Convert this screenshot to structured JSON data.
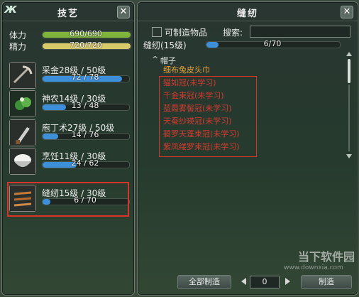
{
  "left_panel": {
    "title": "技艺",
    "close_label": "✕",
    "hp_label": "体力",
    "hp_value": "690/690",
    "hp_fraction": 1.0,
    "mp_label": "精力",
    "mp_value": "720/720",
    "mp_fraction": 1.0,
    "skills": [
      {
        "name": "采金28级 / 50级",
        "progress": "72 / 78",
        "fraction": 0.92,
        "icon": "pickaxe-icon"
      },
      {
        "name": "神农14级 / 30级",
        "progress": "13 / 48",
        "fraction": 0.27,
        "icon": "herb-icon"
      },
      {
        "name": "庖丁术27级 / 50级",
        "progress": "14 / 76",
        "fraction": 0.18,
        "icon": "knife-icon"
      },
      {
        "name": "烹饪11级 / 30级",
        "progress": "24 / 62",
        "fraction": 0.39,
        "icon": "rice-bowl-icon"
      },
      {
        "name": "缝纫15级 / 30级",
        "progress": "6 / 70",
        "fraction": 0.09,
        "icon": "sewing-icon"
      }
    ]
  },
  "right_panel": {
    "title": "缝纫",
    "close_label": "✕",
    "checkbox_label": "可制造物品",
    "search_label": "搜索:",
    "skill_label": "缝纫(15级)",
    "skill_progress": "6/70",
    "skill_fraction": 0.09,
    "category": "帽子",
    "category_marker": "^",
    "items": [
      {
        "name": "细布兔皮头巾",
        "color": "#e8a23a"
      },
      {
        "name": "猫如冠(未学习)",
        "color": "#d33a2e"
      },
      {
        "name": "千金束冠(未学习)",
        "color": "#d33a2e"
      },
      {
        "name": "蓝霞雾髻冠(未学习)",
        "color": "#d33a2e"
      },
      {
        "name": "天蚕纱瑛冠(未学习)",
        "color": "#d33a2e"
      },
      {
        "name": "碧罗天蓬束冠(未学习)",
        "color": "#d33a2e"
      },
      {
        "name": "紫凤缕罗束冠(未学习)",
        "color": "#d33a2e"
      }
    ],
    "make_all_label": "全部制造",
    "quantity": "0",
    "make_label": "制造"
  },
  "watermark": {
    "text": "当下软件园",
    "url": "www.downxia.com"
  },
  "colors": {
    "hp_bar": "#7fb43a",
    "mp_bar": "#d7c86a",
    "skill_bar": "#3d8fd9",
    "highlight": "#d8342a"
  }
}
